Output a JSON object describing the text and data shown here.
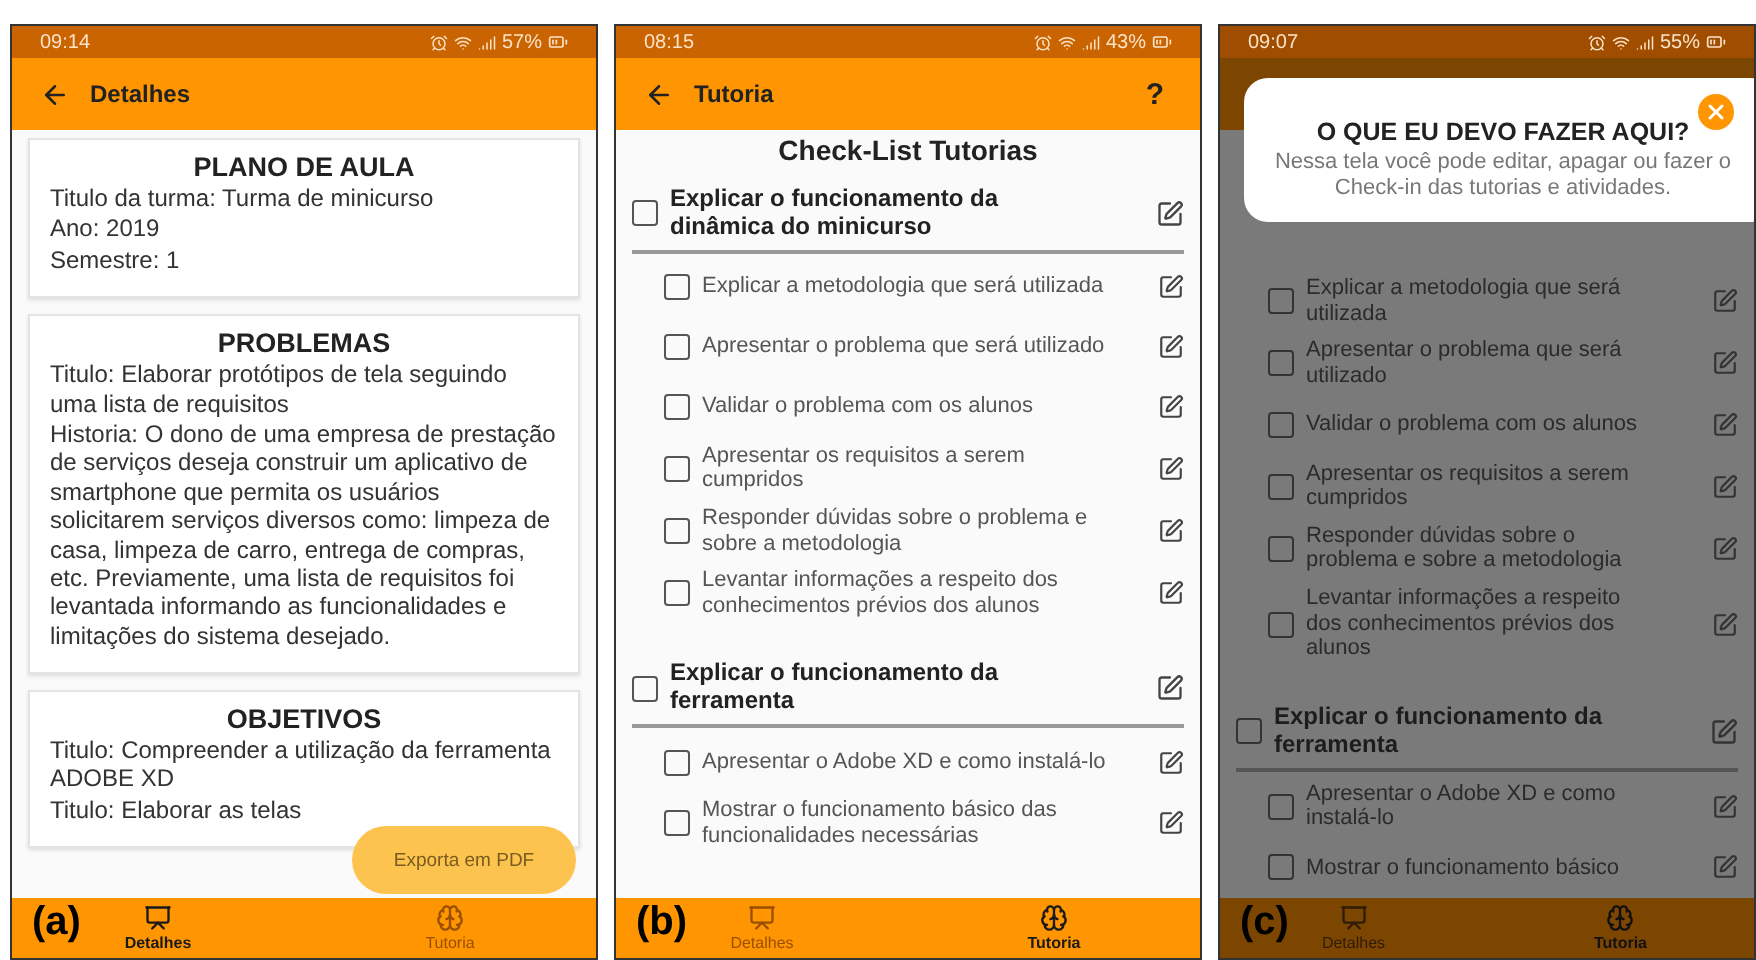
{
  "screens": [
    {
      "kind": "details",
      "label": "(a)",
      "dimmed": false,
      "status": {
        "time": "09:14",
        "battery": "57%"
      },
      "app_bar": {
        "title": "Detalhes"
      },
      "cards": [
        {
          "title": "PLANO DE AULA",
          "paragraphs": [
            "Titulo da turma: Turma de minicurso",
            "Ano: 2019",
            "Semestre: 1"
          ]
        },
        {
          "title": "PROBLEMAS",
          "paragraphs": [
            "Titulo: Elaborar protótipos de tela seguindo uma lista de requisitos",
            "Historia: O dono de uma empresa de prestação de serviços deseja construir um aplicativo de smartphone que permita os usuários solicitarem serviços diversos como: limpeza de casa, limpeza de carro, entrega de compras, etc. Previamente, uma lista de requisitos foi levantada informando as funcionalidades e limitações do sistema desejado."
          ]
        },
        {
          "title": "OBJETIVOS",
          "paragraphs": [
            "Titulo: Compreender a utilização da ferramenta ADOBE XD",
            "Titulo: Elaborar as telas"
          ]
        }
      ],
      "fab": "Exporta em PDF",
      "nav": [
        {
          "label": "Detalhes",
          "selected": true
        },
        {
          "label": "Tutoria",
          "selected": false
        }
      ]
    },
    {
      "kind": "checklist",
      "label": "(b)",
      "dimmed": false,
      "status": {
        "time": "08:15",
        "battery": "43%"
      },
      "app_bar": {
        "title": "Tutoria",
        "help": "?"
      },
      "list_title": "Check-List Tutorias",
      "groups": [
        {
          "heading": "Explicar o funcionamento da dinâmica do minicurso",
          "checked": false,
          "items": [
            {
              "text": "Explicar a metodologia que será utilizada",
              "checked": false
            },
            {
              "text": "Apresentar o problema que será utilizado",
              "checked": false
            },
            {
              "text": "Validar o problema com os alunos",
              "checked": false
            },
            {
              "text": "Apresentar os requisitos a serem cumpridos",
              "checked": false
            },
            {
              "text": "Responder dúvidas sobre o problema e sobre a metodologia",
              "checked": false
            },
            {
              "text": "Levantar informações a respeito dos conhecimentos prévios dos alunos",
              "checked": false
            }
          ]
        },
        {
          "heading": "Explicar o funcionamento da ferramenta",
          "checked": false,
          "items": [
            {
              "text": "Apresentar o Adobe XD e como instalá-lo",
              "checked": false
            },
            {
              "text": "Mostrar o funcionamento básico das funcionalidades necessárias",
              "checked": false
            }
          ]
        }
      ],
      "nav": [
        {
          "label": "Detalhes",
          "selected": false
        },
        {
          "label": "Tutoria",
          "selected": true
        }
      ]
    },
    {
      "kind": "checklist",
      "label": "(c)",
      "dimmed": true,
      "status": {
        "time": "09:07",
        "battery": "55%"
      },
      "dialog": {
        "title": "O QUE EU DEVO FAZER AQUI?",
        "message": "Nessa tela você pode editar, apagar ou fazer o Check-in das tutorias e atividades."
      },
      "groups": [
        {
          "items": [
            {
              "text": "Explicar a metodologia que será utilizada",
              "checked": false
            },
            {
              "text": "Apresentar o problema que será utilizado",
              "checked": false
            },
            {
              "text": "Validar o problema com os alunos",
              "checked": false
            },
            {
              "text": "Apresentar os requisitos a serem cumpridos",
              "checked": false
            },
            {
              "text": "Responder dúvidas sobre o problema e sobre a metodologia",
              "checked": false
            },
            {
              "text": "Levantar informações a respeito dos conhecimentos prévios dos alunos",
              "checked": false
            }
          ]
        },
        {
          "heading": "Explicar o funcionamento da ferramenta",
          "checked": false,
          "items": [
            {
              "text": "Apresentar o Adobe XD e como instalá-lo",
              "checked": false
            },
            {
              "text": "Mostrar o funcionamento básico",
              "checked": false
            }
          ]
        }
      ],
      "nav": [
        {
          "label": "Detalhes",
          "selected": false
        },
        {
          "label": "Tutoria",
          "selected": true
        }
      ]
    }
  ]
}
